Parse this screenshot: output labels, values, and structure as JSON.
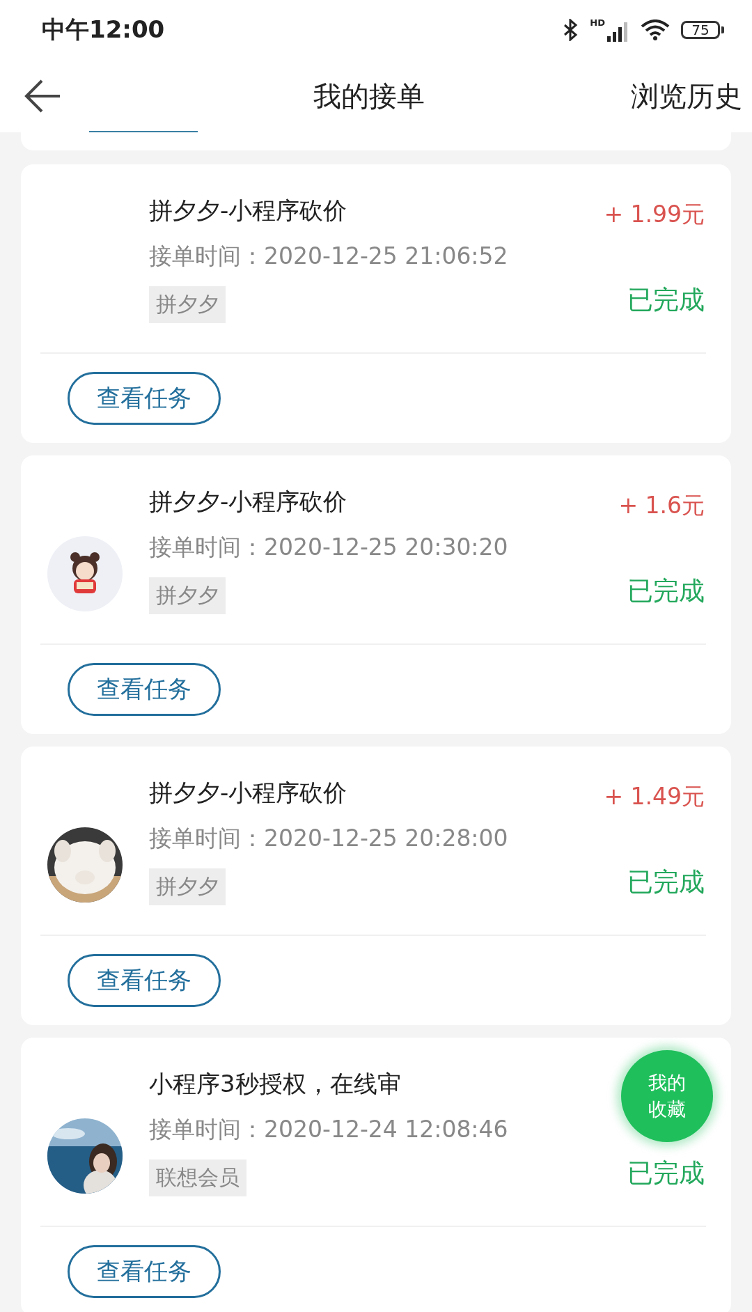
{
  "status_bar": {
    "time": "中午12:00",
    "network_label": "HD",
    "battery": "75"
  },
  "nav": {
    "title": "我的接单",
    "action": "浏览历史"
  },
  "orders": [
    {
      "avatar": false,
      "title": "拼夕夕-小程序砍价",
      "time": "接单时间：2020-12-25 21:06:52",
      "tag": "拼夕夕",
      "amount": "+ 1.99元",
      "status": "已完成",
      "button": "查看任务"
    },
    {
      "avatar": true,
      "title": "拼夕夕-小程序砍价",
      "time": "接单时间：2020-12-25 20:30:20",
      "tag": "拼夕夕",
      "amount": "+ 1.6元",
      "status": "已完成",
      "button": "查看任务"
    },
    {
      "avatar": true,
      "title": "拼夕夕-小程序砍价",
      "time": "接单时间：2020-12-25 20:28:00",
      "tag": "拼夕夕",
      "amount": "+ 1.49元",
      "status": "已完成",
      "button": "查看任务"
    },
    {
      "avatar": true,
      "title": "小程序3秒授权，在线审",
      "time": "接单时间：2020-12-24 12:08:46",
      "tag": "联想会员",
      "status": "已完成",
      "button": "查看任务"
    }
  ],
  "float_button": {
    "line_1": "我的",
    "line_2": "收藏"
  }
}
